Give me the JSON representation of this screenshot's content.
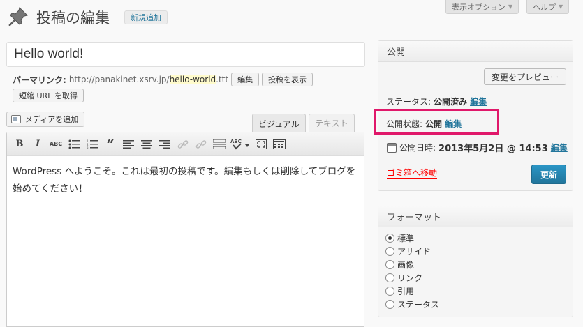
{
  "screen_options": {
    "display_options": "表示オプション",
    "help": "ヘルプ"
  },
  "header": {
    "title": "投稿の編集",
    "add_new": "新規追加"
  },
  "post": {
    "title": "Hello world!",
    "permalink_label": "パーマリンク:",
    "permalink_base": "http://panakinet.xsrv.jp/",
    "permalink_slug": "hello-world",
    "permalink_suffix": ".ttt",
    "edit_button": "編集",
    "view_button": "投稿を表示",
    "shortlink_button": "短縮 URL を取得"
  },
  "editor": {
    "add_media": "メディアを追加",
    "tab_visual": "ビジュアル",
    "tab_text": "テキスト",
    "content": "WordPress へようこそ。これは最初の投稿です。編集もしくは削除してブログを始めてください！",
    "toolbar": [
      {
        "name": "bold-icon",
        "glyph": "B"
      },
      {
        "name": "italic-icon",
        "glyph": "I"
      },
      {
        "name": "strikethrough-icon",
        "glyph": "ABC"
      },
      {
        "name": "bullet-list-icon",
        "glyph": "≡"
      },
      {
        "name": "numbered-list-icon",
        "glyph": "≡"
      },
      {
        "name": "blockquote-icon",
        "glyph": "“"
      },
      {
        "name": "align-left-icon",
        "glyph": "≡"
      },
      {
        "name": "align-center-icon",
        "glyph": "≡"
      },
      {
        "name": "align-right-icon",
        "glyph": "≡"
      },
      {
        "name": "link-icon",
        "glyph": "⚭"
      },
      {
        "name": "unlink-icon",
        "glyph": "⚭"
      },
      {
        "name": "more-tag-icon",
        "glyph": "▭"
      },
      {
        "name": "spellcheck-icon",
        "glyph": "ABC"
      },
      {
        "name": "fullscreen-icon",
        "glyph": "⛶"
      },
      {
        "name": "kitchen-sink-icon",
        "glyph": "▦"
      }
    ]
  },
  "publish": {
    "title": "公開",
    "preview": "変更をプレビュー",
    "status_label": "ステータス:",
    "status_value": "公開済み",
    "status_edit": "編集",
    "visibility_label": "公開状態:",
    "visibility_value": "公開",
    "visibility_edit": "編集",
    "date_label": "公開日時:",
    "date_value": "2013年5月2日 @ 14:53",
    "date_edit": "編集",
    "trash": "ゴミ箱へ移動",
    "update": "更新"
  },
  "format": {
    "title": "フォーマット",
    "options": [
      "標準",
      "アサイド",
      "画像",
      "リンク",
      "引用",
      "ステータス"
    ],
    "selected": 0
  },
  "colors": {
    "link": "#21759b",
    "highlight": "#e0186a",
    "trash": "#ff0000",
    "primary": "#21759b"
  }
}
